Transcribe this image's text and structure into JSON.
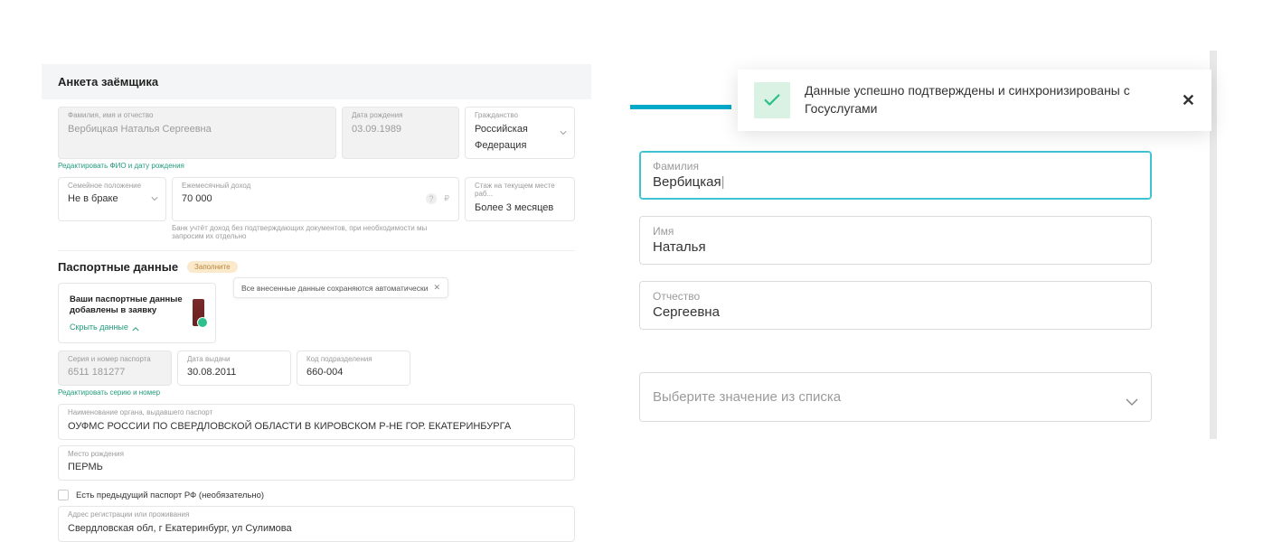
{
  "left": {
    "title": "Анкета заёмщика",
    "fio_label": "Фамилия, имя и отчество",
    "fio_value": "Вербицкая Наталья Сергеевна",
    "dob_label": "Дата рождения",
    "dob_value": "03.09.1989",
    "citizenship_label": "Гражданство",
    "citizenship_value": "Российская Федерация",
    "edit_fio": "Редактировать ФИО и дату рождения",
    "marital_label": "Семейное положение",
    "marital_value": "Не в браке",
    "income_label": "Ежемесячный доход",
    "income_value": "70 000",
    "income_hint": "Банк учтёт доход без подтверждающих документов, при необходимости мы запросим их отдельно",
    "tenure_label": "Стаж на текущем месте раб...",
    "tenure_value": "Более 3 месяцев",
    "passport_section": "Паспортные данные",
    "fill_tag": "Заполните",
    "passport_card_text": "Ваши паспортные данные добавлены в заявку",
    "hide_link": "Скрыть данные",
    "tooltip_text": "Все внесенные данные сохраняются автоматически",
    "series_label": "Серия и номер паспорта",
    "series_value": "6511 181277",
    "issue_date_label": "Дата выдачи",
    "issue_date_value": "30.08.2011",
    "dept_code_label": "Код подразделения",
    "dept_code_value": "660-004",
    "edit_series": "Редактировать серию и номер",
    "issuer_label": "Наименование органа, выдавшего паспорт",
    "issuer_value": "ОУФМС РОССИИ ПО СВЕРДЛОВСКОЙ ОБЛАСТИ В КИРОВСКОМ Р-НЕ ГОР. ЕКАТЕРИНБУРГА",
    "birthplace_label": "Место рождения",
    "birthplace_value": "ПЕРМЬ",
    "prev_passport": "Есть предыдущий паспорт РФ (необязательно)",
    "address_label": "Адрес регистрации или проживания",
    "address_value": "Свердловская обл, г Екатеринбург, ул Сулимова"
  },
  "right": {
    "notification": "Данные успешно подтверждены и синхронизированы с Госуслугами",
    "lastname_label": "Фамилия",
    "lastname_value": "Вербицкая",
    "firstname_label": "Имя",
    "firstname_value": "Наталья",
    "patronymic_label": "Отчество",
    "patronymic_value": "Сергеевна",
    "select_placeholder": "Выберите значение из списка"
  }
}
